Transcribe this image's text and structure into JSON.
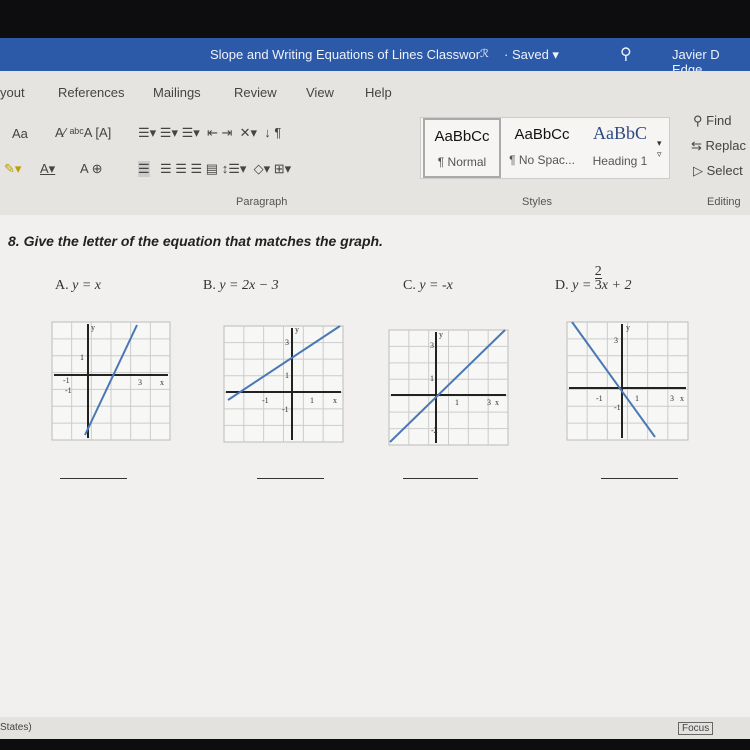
{
  "titlebar": {
    "doc_title": "Slope and Writing Equations of Lines Classwor",
    "saved": "· Saved ▾",
    "user": "Javier D Edge"
  },
  "ribbon": {
    "tabs": [
      "yout",
      "References",
      "Mailings",
      "Review",
      "View",
      "Help"
    ],
    "groups": {
      "paragraph": "Paragraph",
      "styles": "Styles",
      "editing": "Editing"
    },
    "styles": [
      {
        "preview": "AaBbCc",
        "name": "¶ Normal"
      },
      {
        "preview": "AaBbCc",
        "name": "¶ No Spac..."
      },
      {
        "preview": "AaBbC",
        "name": "Heading 1"
      }
    ],
    "editing": {
      "find": "Find",
      "replace": "Replac",
      "select": "Select"
    },
    "font_change_case": "Aa"
  },
  "document": {
    "question": "8. Give the letter of the equation that matches the graph.",
    "options": [
      {
        "letter": "A.",
        "equation": "y = x"
      },
      {
        "letter": "B.",
        "equation": "y = 2x − 3"
      },
      {
        "letter": "C.",
        "equation": "y = -x"
      },
      {
        "letter": "D.",
        "equation_prefix": "y =",
        "numerator": "2",
        "denominator": "3",
        "equation_suffix": "x + 2"
      }
    ],
    "graph_labels": {
      "x": "x",
      "y": "y",
      "one": "1",
      "neg_one": "-1",
      "three": "3",
      "neg_two": "-2"
    }
  },
  "status": {
    "left": "States)",
    "focus": "Focus"
  },
  "colors": {
    "title_bar": "#2c5aa8",
    "graph_line": "#4a78b5"
  }
}
